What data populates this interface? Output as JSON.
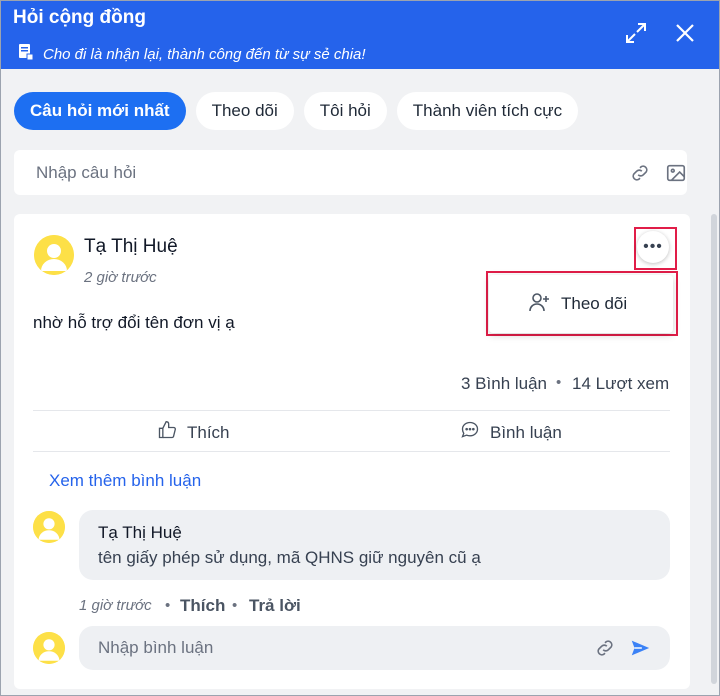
{
  "header": {
    "title": "Hỏi cộng đồng",
    "subtitle": "Cho đi là nhận lại, thành công đến từ sự sẻ chia!"
  },
  "tabs": [
    {
      "label": "Câu hỏi mới nhất",
      "active": true
    },
    {
      "label": "Theo dõi",
      "active": false
    },
    {
      "label": "Tôi hỏi",
      "active": false
    },
    {
      "label": "Thành viên tích cực",
      "active": false
    }
  ],
  "ask": {
    "placeholder": "Nhập câu hỏi"
  },
  "post": {
    "author": "Tạ Thị Huệ",
    "time": "2 giờ trước",
    "content": "nhờ hỗ trợ đổi tên đơn vị ạ",
    "comments_count": "3 Bình luận",
    "views_count": "14 Lượt xem",
    "separator": "•",
    "like_label": "Thích",
    "comment_label": "Bình luận",
    "more_comments": "Xem thêm bình luận"
  },
  "menu": {
    "follow_label": "Theo dõi"
  },
  "comment": {
    "author": "Tạ Thị Huệ",
    "text": "tên giấy phép sử dụng, mã QHNS giữ nguyên cũ ạ",
    "time": "1 giờ trước",
    "sep": "•",
    "like": "Thích",
    "reply": "Trả lời"
  },
  "comment_input": {
    "placeholder": "Nhập bình luận"
  },
  "colors": {
    "primary": "#2563eb",
    "highlight": "#e11d48",
    "avatar": "#fde047"
  }
}
